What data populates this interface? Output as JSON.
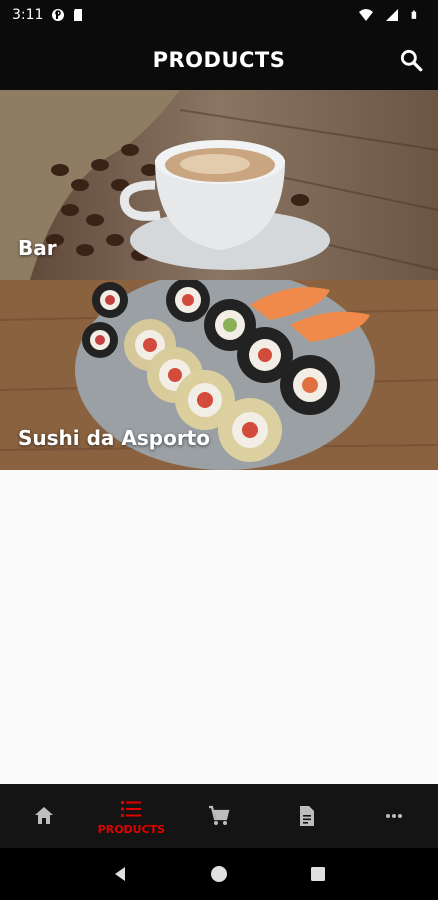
{
  "status": {
    "time": "3:11"
  },
  "appbar": {
    "title": "PRODUCTS"
  },
  "categories": [
    {
      "label": "Bar"
    },
    {
      "label": "Sushi da Asporto"
    }
  ],
  "bottom_nav": {
    "items": [
      {
        "icon": "home-icon",
        "label": ""
      },
      {
        "icon": "list-icon",
        "label": "PRODUCTS",
        "active": true
      },
      {
        "icon": "cart-icon",
        "label": ""
      },
      {
        "icon": "document-icon",
        "label": ""
      },
      {
        "icon": "more-icon",
        "label": ""
      }
    ]
  },
  "colors": {
    "accent": "#e00000",
    "bar_bg": "#0b0b0b"
  }
}
